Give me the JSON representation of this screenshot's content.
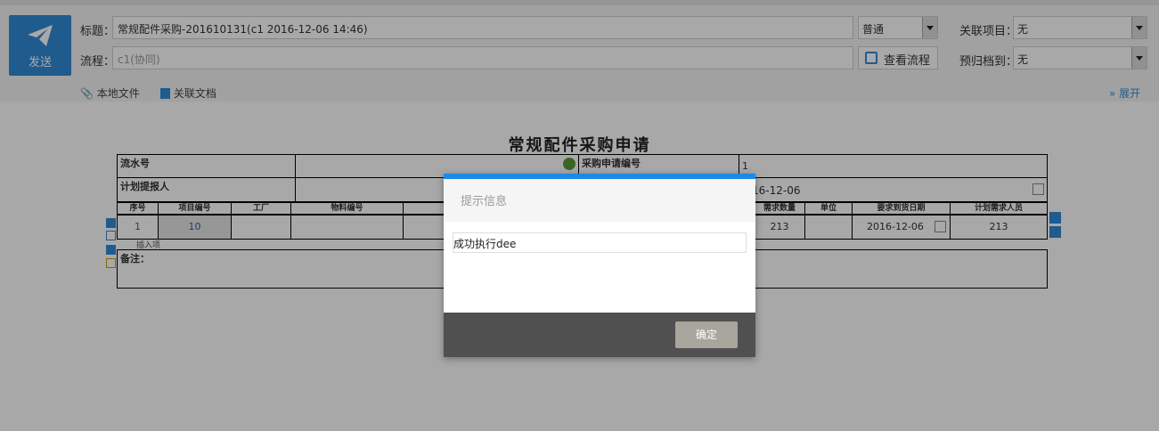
{
  "toolbar": {
    "send_label": "发送",
    "subject_label": "标题：",
    "subject_value": "常规配件采购-201610131(c1 2016-12-06 14:46)",
    "flow_label": "流程：",
    "flow_placeholder": "c1(协同)",
    "priority_value": "普通",
    "view_flow_label": "查看流程",
    "related_project_label": "关联项目：",
    "related_project_value": "无",
    "archive_label": "预归档到：",
    "archive_value": "无",
    "local_file_label": "本地文件",
    "related_doc_label": "关联文档",
    "expand_label": "展开"
  },
  "form": {
    "title": "常规配件采购申请",
    "serial_label": "流水号",
    "purchase_no_label": "采购申请编号",
    "purchase_no_value": "1",
    "planner_label": "计划提报人",
    "date_value": "16-12-06",
    "columns": [
      "序号",
      "项目编号",
      "工厂",
      "物料编号",
      "需求数量",
      "单位",
      "要求到货日期",
      "计划需求人员"
    ],
    "row": {
      "seq": "1",
      "project_no": "10",
      "factory": "",
      "material_no": "",
      "qty": "213",
      "unit": "",
      "due_date": "2016-12-06",
      "planner": "213"
    },
    "insert_label": "插入项",
    "remark_label": "备注："
  },
  "dialog": {
    "title": "提示信息",
    "message": "成功执行dee",
    "ok_label": "确定"
  },
  "colors": {
    "accent": "#2f8ad6",
    "dialog_bar": "#1a8ae6",
    "dialog_footer": "#505050",
    "ok_button": "#a8a59c"
  }
}
